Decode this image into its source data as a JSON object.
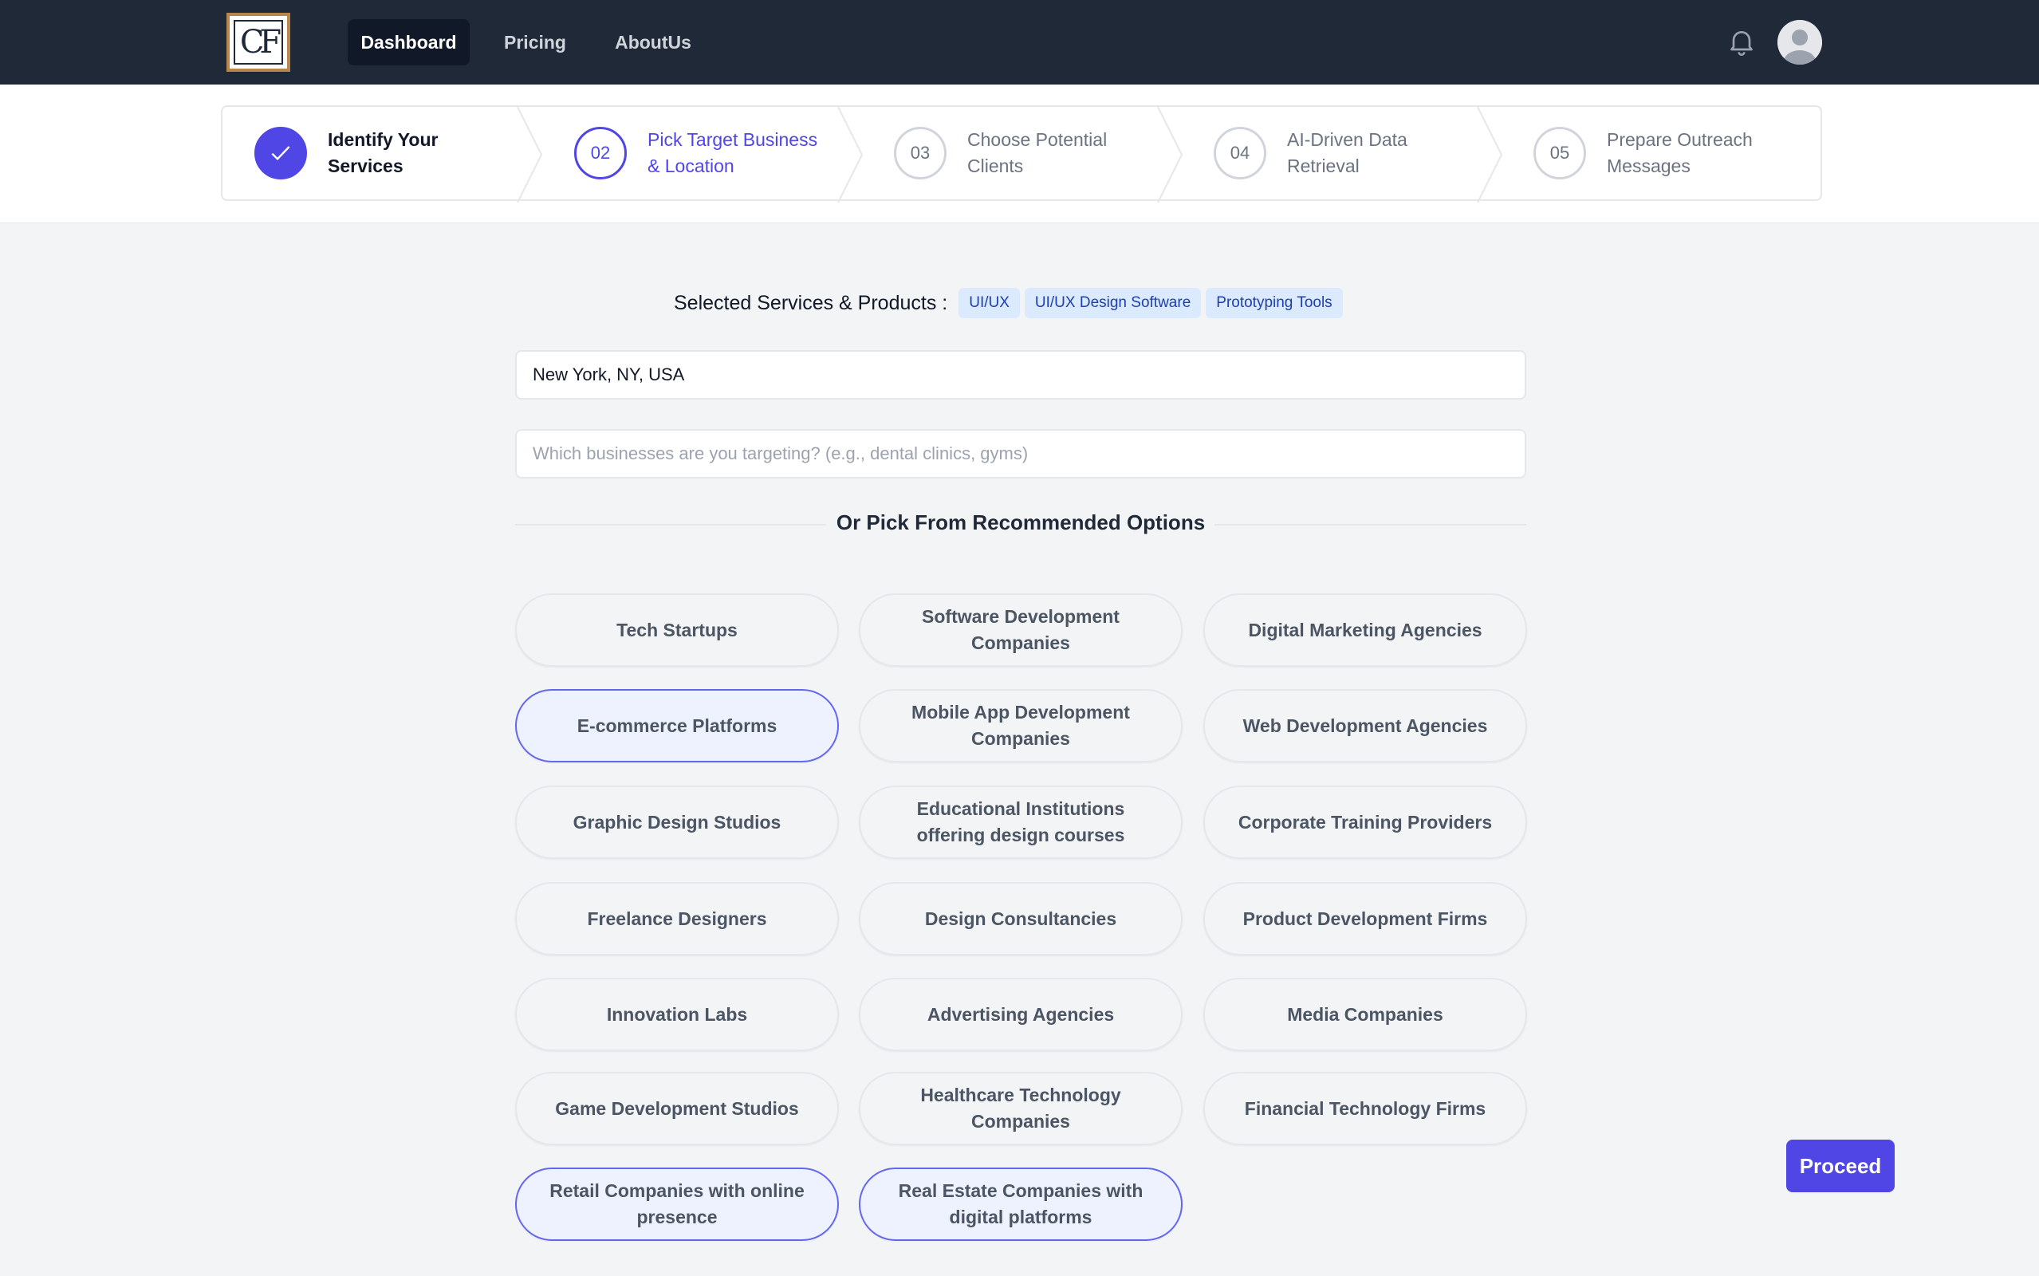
{
  "nav": {
    "logo_text": "CF",
    "links": [
      "Dashboard",
      "Pricing",
      "AboutUs"
    ],
    "bell_icon": "bell-icon",
    "avatar_icon": "user-avatar-icon"
  },
  "stepper": {
    "steps": [
      {
        "number": "",
        "label": "Identify Your Services",
        "state": "done"
      },
      {
        "number": "02",
        "label": "Pick Target Business & Location",
        "state": "current"
      },
      {
        "number": "03",
        "label": "Choose Potential Clients",
        "state": "upcoming"
      },
      {
        "number": "04",
        "label": "AI-Driven Data Retrieval",
        "state": "upcoming"
      },
      {
        "number": "05",
        "label": "Prepare Outreach Messages",
        "state": "upcoming"
      }
    ]
  },
  "selected": {
    "label": "Selected Services & Products :",
    "chips": [
      "UI/UX",
      "UI/UX Design Software",
      "Prototyping Tools"
    ]
  },
  "location_input": {
    "value": "New York, NY, USA"
  },
  "business_input": {
    "value": "",
    "placeholder": "Which businesses are you targeting? (e.g., dental clinics, gyms)"
  },
  "recommended_heading": "Or Pick From Recommended Options",
  "options": [
    "Tech Startups",
    "Software Development Companies",
    "Digital Marketing Agencies",
    "E-commerce Platforms",
    "Mobile App Development Companies",
    "Web Development Agencies",
    "Graphic Design Studios",
    "Educational Institutions offering design courses",
    "Corporate Training Providers",
    "Freelance Designers",
    "Design Consultancies",
    "Product Development Firms",
    "Innovation Labs",
    "Advertising Agencies",
    "Media Companies",
    "Game Development Studios",
    "Healthcare Technology Companies",
    "Financial Technology Firms",
    "Retail Companies with online presence",
    "Real Estate Companies with digital platforms"
  ],
  "highlighted_options": [
    "E-commerce Platforms",
    "Retail Companies with online presence",
    "Real Estate Companies with digital platforms"
  ],
  "proceed_label": "Proceed",
  "colors": {
    "accent": "#4f46e5",
    "nav_bg": "#1f2937",
    "chip_bg": "#dbeafe",
    "chip_text": "#1e40af"
  }
}
